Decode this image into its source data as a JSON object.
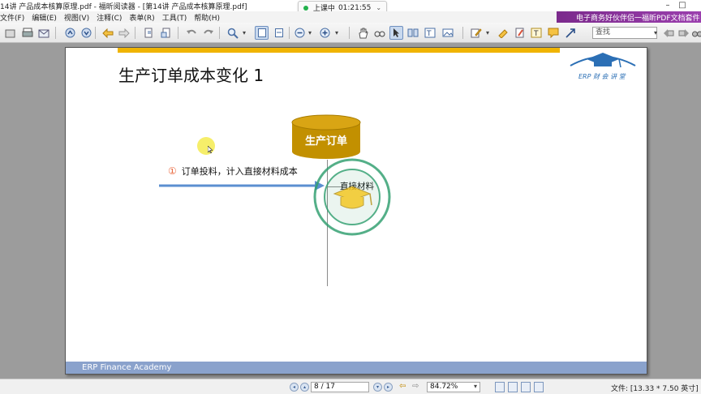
{
  "window": {
    "title": "14讲 产品成本核算原理.pdf - 福昕阅读器 - [第14讲 产品成本核算原理.pdf]",
    "minimize": "–",
    "maximize": "□"
  },
  "live_session": {
    "status": "上课中",
    "time": "01:21:55",
    "chevron": "⌄"
  },
  "menu": [
    {
      "label": "文件(F)"
    },
    {
      "label": "编辑(E)"
    },
    {
      "label": "视图(V)"
    },
    {
      "label": "注释(C)"
    },
    {
      "label": "表单(R)"
    },
    {
      "label": "工具(T)"
    },
    {
      "label": "帮助(H)"
    }
  ],
  "ad_banner": "电子商务好伙伴侣一福昕PDF文档套件",
  "toolbar": {
    "search_placeholder": "查找"
  },
  "slide": {
    "title": "生产订单成本变化 1",
    "logo_text": "ERP 财 会 讲 堂",
    "cylinder_label": "生产订单",
    "step_number": "①",
    "step_text": "订单投料，计入直接材料成本",
    "material_label": "直接材料",
    "watermark_top": "ERP 财 会 讲 堂",
    "watermark_bottom": "ERP Finance Academy",
    "footer": "ERP Finance Academy"
  },
  "colors": {
    "accent_gold": "#f0b400",
    "cylinder": "#c29000",
    "arrow": "#5b8fd0",
    "footer": "#8aa2cc",
    "watermark": "#2f9e6e"
  },
  "statusbar": {
    "page_indicator": "8 / 17",
    "zoom": "84.72%",
    "file_size": "文件: [13.33 * 7.50 英寸]"
  }
}
